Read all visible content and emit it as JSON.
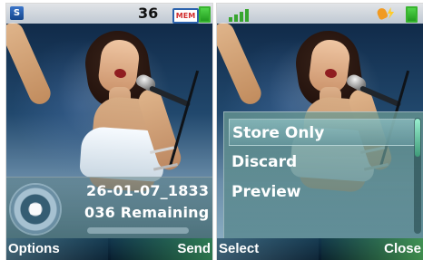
{
  "left_screen": {
    "status": {
      "count": "36",
      "memory_card": "MEM",
      "icons": {
        "sim": "sim-icon",
        "memory": "memory-card-icon",
        "battery": "battery-icon"
      }
    },
    "overlay": {
      "filename": "26-01-07_1833",
      "remaining": "036 Remaining",
      "progress_percent": 0
    },
    "softkeys": {
      "left": "Options",
      "right": "Send"
    }
  },
  "right_screen": {
    "status": {
      "icons": {
        "signal": "signal-icon",
        "alert": "phone-alert-icon",
        "battery": "battery-icon"
      }
    },
    "menu": {
      "items": [
        {
          "label": "Store Only",
          "selected": true
        },
        {
          "label": "Discard",
          "selected": false
        },
        {
          "label": "Preview",
          "selected": false
        }
      ]
    },
    "softkeys": {
      "left": "Select",
      "right": "Close"
    }
  },
  "colors": {
    "text": "#ffffff",
    "accent_blue": "#2ba2df",
    "accent_green": "#38a62f",
    "memory_red": "#d22d2d"
  }
}
